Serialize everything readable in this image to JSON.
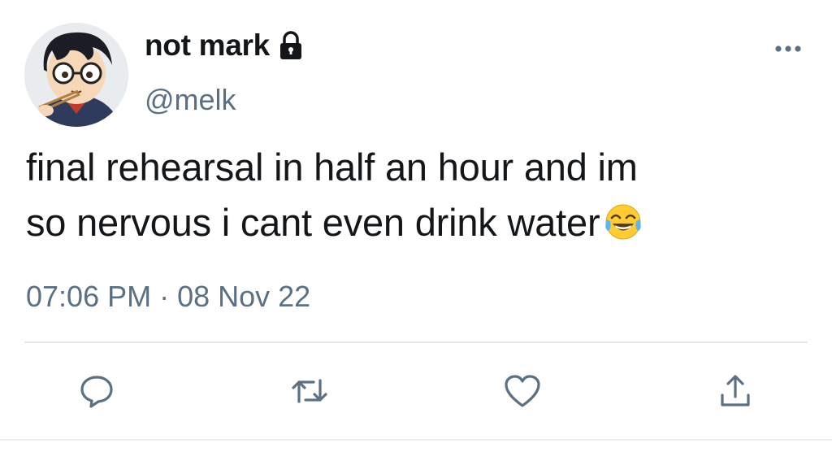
{
  "tweet": {
    "display_name": "not mark",
    "handle": "@melk",
    "text_line1": "final rehearsal in half an hour and im",
    "text_line2": "so nervous i cant even drink water",
    "emoji": "face-with-tears-of-joy",
    "timestamp": "07:06 PM · 08 Nov 22",
    "protected": true
  },
  "icons": {
    "header": [
      "lock-icon",
      "more-icon"
    ],
    "actions": [
      "reply-icon",
      "retweet-icon",
      "like-icon",
      "share-icon"
    ]
  },
  "colors": {
    "text": "#14171a",
    "secondary": "#5b7083",
    "divider": "#e1e8ed"
  }
}
